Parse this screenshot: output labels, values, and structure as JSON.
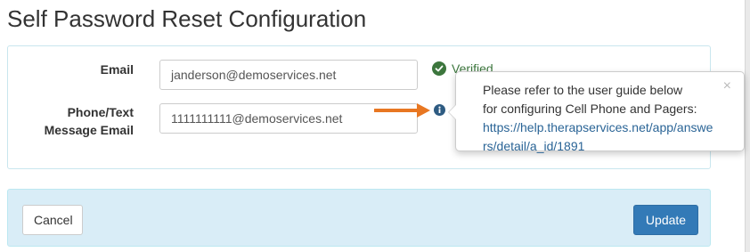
{
  "page": {
    "title": "Self Password Reset Configuration"
  },
  "form": {
    "email": {
      "label": "Email",
      "value": "janderson@demoservices.net",
      "status_text": "Verified",
      "status_icon": "check-circle-icon"
    },
    "phone": {
      "label_line1": "Phone/Text",
      "label_line2": "Message Email",
      "value": "1111111111@demoservices.net",
      "help_icon": "info-icon"
    }
  },
  "popover": {
    "line1": "Please refer to the user guide below",
    "line2": "for configuring Cell Phone and Pagers:",
    "link": "https://help.therapservices.net/app/answers/detail/a_id/1891",
    "close_symbol": "×"
  },
  "actions": {
    "cancel_label": "Cancel",
    "update_label": "Update"
  },
  "colors": {
    "verified_green": "#3c763d",
    "primary_button": "#337ab7",
    "action_bar_bg": "#d9edf7",
    "annotation_arrow": "#e87722",
    "link": "#2a6496"
  }
}
